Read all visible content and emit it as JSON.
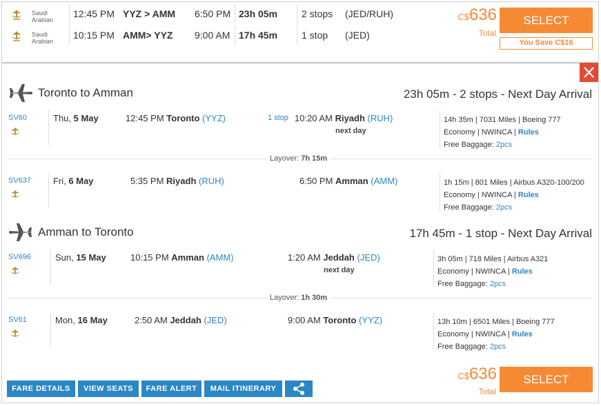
{
  "summary": {
    "airline_name_line1": "Saudi",
    "airline_name_line2": "Arabian",
    "outbound": {
      "dep_time": "12:45 PM",
      "route": "YYZ  > AMM",
      "arr_time": "6:50 PM",
      "duration": "23h 05m",
      "stops": "2 stops",
      "via": "(JED/RUH)"
    },
    "return": {
      "dep_time": "10:15 PM",
      "route": "AMM> YYZ",
      "arr_time": "9:00 AM",
      "duration": "17h 45m",
      "stops": "1 stop",
      "via": "(JED)"
    },
    "currency": "C$",
    "price": "636",
    "total_label": "Total",
    "select_label": "SELECT",
    "savings": "You Save C$16"
  },
  "outbound_header": {
    "title": "Toronto to Amman",
    "summary": "23h 05m - 2 stops - Next Day Arrival"
  },
  "return_header": {
    "title": "Amman to Toronto",
    "summary": "17h 45m - 1 stop - Next Day Arrival"
  },
  "segments": [
    {
      "flight": "SV60",
      "day": "Thu,",
      "date": "5 May",
      "dep_time": "12:45 PM",
      "dep_city": "Toronto",
      "dep_code": "(YYZ)",
      "stop_note": "1 stop",
      "arr_time": "10:20 AM",
      "arr_city": "Riyadh",
      "arr_code": "(RUH)",
      "next_day": "next day",
      "info": "14h 35m | 7031 Miles | Boeing 777",
      "cabin": "Economy | NWINCA |",
      "rules": "Rules",
      "baggage_label": "Free Baggage:",
      "baggage": "2pcs"
    },
    {
      "flight": "SV637",
      "day": "Fri,",
      "date": "6 May",
      "dep_time": "5:35 PM",
      "dep_city": "Riyadh",
      "dep_code": "(RUH)",
      "stop_note": "",
      "arr_time": "6:50 PM",
      "arr_city": "Amman",
      "arr_code": "(AMM)",
      "next_day": "",
      "info": "1h 15m | 801 Miles | Airbus A320-100/200",
      "cabin": "Economy | NWINCA |",
      "rules": "Rules",
      "baggage_label": "Free Baggage:",
      "baggage": "2pcs"
    },
    {
      "flight": "SV696",
      "day": "Sun,",
      "date": "15 May",
      "dep_time": "10:15 PM",
      "dep_city": "Amman",
      "dep_code": "(AMM)",
      "stop_note": "",
      "arr_time": "1:20 AM",
      "arr_city": "Jeddah",
      "arr_code": "(JED)",
      "next_day": "next day",
      "info": "3h 05m | 718 Miles | Airbus A321",
      "cabin": "Economy | NWINCA |",
      "rules": "Rules",
      "baggage_label": "Free Baggage:",
      "baggage": "2pcs"
    },
    {
      "flight": "SV61",
      "day": "Mon,",
      "date": "16 May",
      "dep_time": "2:50 AM",
      "dep_city": "Jeddah",
      "dep_code": "(JED)",
      "stop_note": "",
      "arr_time": "9:00 AM",
      "arr_city": "Toronto",
      "arr_code": "(YYZ)",
      "next_day": "",
      "info": "13h 10m | 6501 Miles | Boeing 777",
      "cabin": "Economy | NWINCA |",
      "rules": "Rules",
      "baggage_label": "Free Baggage:",
      "baggage": "2pcs"
    }
  ],
  "layovers": [
    {
      "label": "Layover:",
      "duration": "7h 15m"
    },
    {
      "label": "Layover:",
      "duration": "1h 30m"
    }
  ],
  "footer": {
    "buttons": [
      "FARE DETAILS",
      "VIEW SEATS",
      "FARE ALERT",
      "MAIL ITINERARY"
    ],
    "share_icon": "share-icon",
    "currency": "C$",
    "price": "636",
    "total_label": "Total",
    "select_label": "SELECT"
  },
  "colors": {
    "accent": "#f68a33",
    "link": "#2b86c5",
    "close": "#e24b35"
  }
}
